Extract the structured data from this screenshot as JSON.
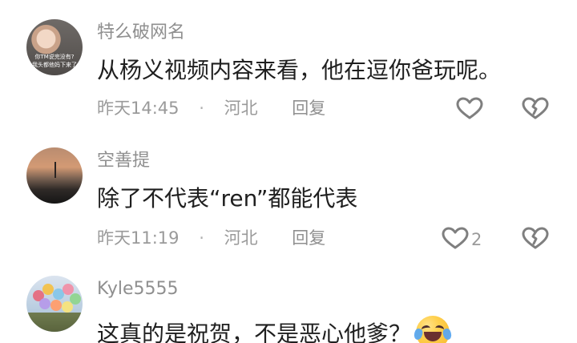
{
  "comments": [
    {
      "avatar_overlay": [
        "你TM说完没有?",
        "我头都他妈下来了"
      ],
      "username": "特么破网名",
      "text": "从杨义视频内容来看，他在逗你爸玩呢。",
      "date": "昨天14:45",
      "separator": "·",
      "region": "河北",
      "reply_label": "回复",
      "like_icon": "heart-outline-icon",
      "dislike_icon": "broken-heart-icon"
    },
    {
      "username": "空善提",
      "text": "除了不代表“ren”都能代表",
      "date": "昨天11:19",
      "separator": "·",
      "region": "河北",
      "reply_label": "回复",
      "like_count": "2",
      "like_icon": "heart-outline-icon",
      "dislike_icon": "broken-heart-icon"
    },
    {
      "username": "Kyle5555",
      "text": "这真的是祝贺，不是恶心他爹？",
      "emoji_icon": "crying-laughing-emoji-icon"
    }
  ]
}
